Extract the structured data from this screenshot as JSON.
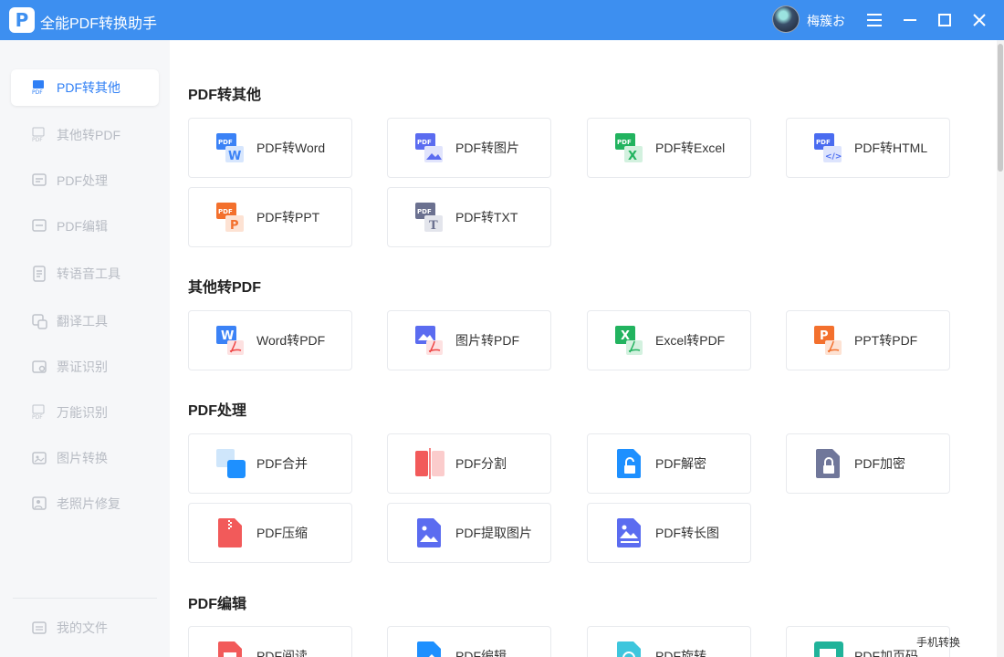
{
  "app": {
    "title": "全能PDF转换助手",
    "username": "梅簇お",
    "logo_letter": "P"
  },
  "sidebar": {
    "items": [
      {
        "label": "PDF转其他",
        "icon": "pdf-icon",
        "active": true
      },
      {
        "label": "其他转PDF",
        "icon": "pdf-icon"
      },
      {
        "label": "PDF处理",
        "icon": "pdf-process-icon"
      },
      {
        "label": "PDF编辑",
        "icon": "pdf-edit-icon"
      },
      {
        "label": "转语音工具",
        "icon": "document-icon"
      },
      {
        "label": "翻译工具",
        "icon": "translate-icon"
      },
      {
        "label": "票证识别",
        "icon": "ticket-icon"
      },
      {
        "label": "万能识别",
        "icon": "pdf-icon"
      },
      {
        "label": "图片转换",
        "icon": "image-convert-icon"
      },
      {
        "label": "老照片修复",
        "icon": "photo-repair-icon"
      }
    ],
    "my_files": "我的文件"
  },
  "sections": [
    {
      "title": "PDF转其他",
      "cards": [
        {
          "label": "PDF转Word",
          "icon": "pdf-to-word-icon"
        },
        {
          "label": "PDF转图片",
          "icon": "pdf-to-image-icon"
        },
        {
          "label": "PDF转Excel",
          "icon": "pdf-to-excel-icon"
        },
        {
          "label": "PDF转HTML",
          "icon": "pdf-to-html-icon"
        },
        {
          "label": "PDF转PPT",
          "icon": "pdf-to-ppt-icon"
        },
        {
          "label": "PDF转TXT",
          "icon": "pdf-to-txt-icon"
        }
      ]
    },
    {
      "title": "其他转PDF",
      "cards": [
        {
          "label": "Word转PDF",
          "icon": "word-to-pdf-icon"
        },
        {
          "label": "图片转PDF",
          "icon": "image-to-pdf-icon"
        },
        {
          "label": "Excel转PDF",
          "icon": "excel-to-pdf-icon"
        },
        {
          "label": "PPT转PDF",
          "icon": "ppt-to-pdf-icon"
        }
      ]
    },
    {
      "title": "PDF处理",
      "cards": [
        {
          "label": "PDF合并",
          "icon": "merge-icon"
        },
        {
          "label": "PDF分割",
          "icon": "split-icon"
        },
        {
          "label": "PDF解密",
          "icon": "unlock-icon"
        },
        {
          "label": "PDF加密",
          "icon": "lock-icon"
        },
        {
          "label": "PDF压缩",
          "icon": "compress-icon"
        },
        {
          "label": "PDF提取图片",
          "icon": "extract-image-icon"
        },
        {
          "label": "PDF转长图",
          "icon": "long-image-icon"
        }
      ]
    },
    {
      "title": "PDF编辑",
      "cards": [
        {
          "label": "PDF阅读",
          "icon": "read-icon"
        },
        {
          "label": "PDF编辑",
          "icon": "edit-icon"
        },
        {
          "label": "PDF旋转",
          "icon": "rotate-icon"
        },
        {
          "label": "PDF加页码",
          "icon": "page-number-icon"
        }
      ]
    }
  ],
  "footer": {
    "mobile_convert": "手机转换"
  },
  "colors": {
    "titlebar": "#3d8ff0",
    "accent": "#2f7ff5",
    "word": "#3b82f6",
    "excel": "#22b35f",
    "ppt": "#f3702d",
    "red": "#f25a5a",
    "purple": "#5b6cf0"
  },
  "badge_text": {
    "pdf": "PDF",
    "word": "W",
    "excel": "X",
    "ppt": "P",
    "txt": "T",
    "html": "</>"
  }
}
